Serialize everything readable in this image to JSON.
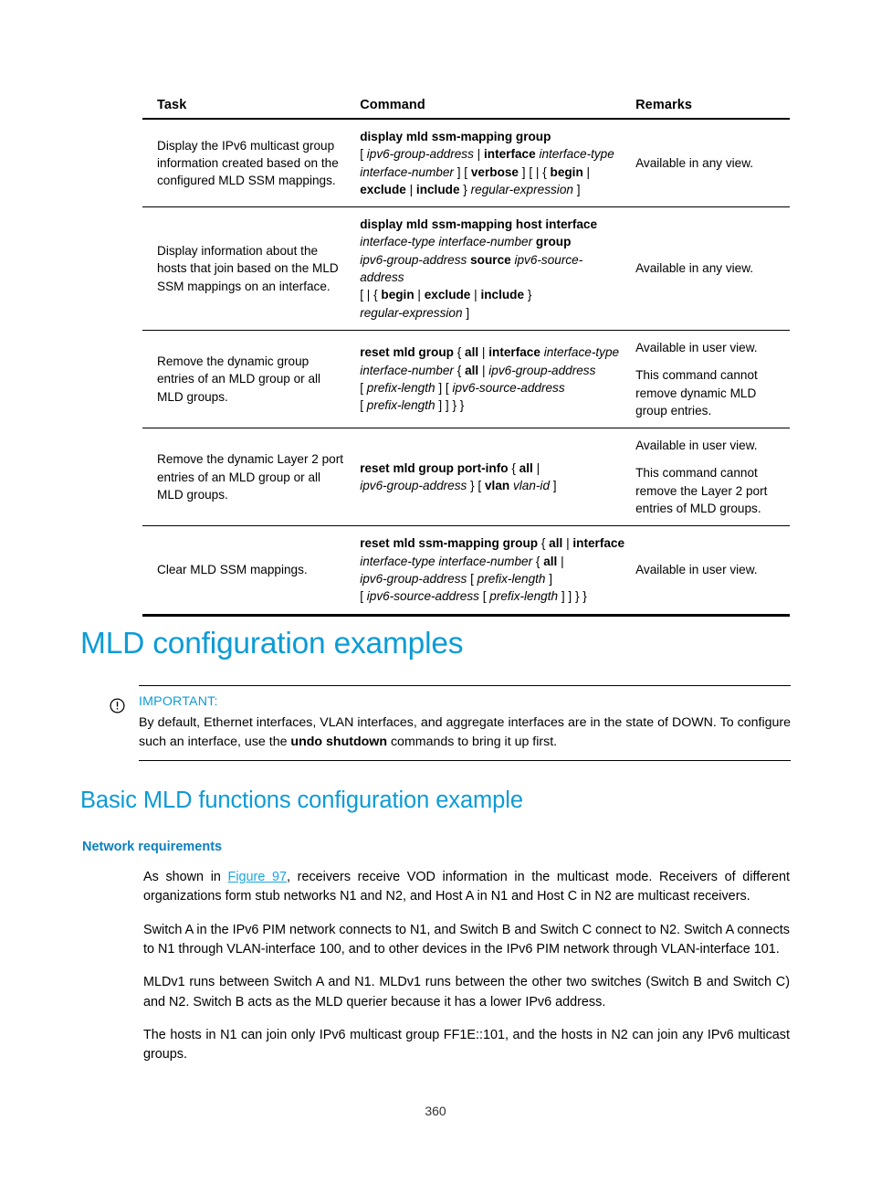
{
  "table": {
    "headers": [
      "Task",
      "Command",
      "Remarks"
    ],
    "rows": [
      {
        "task": "Display the IPv6 multicast group information created based on the configured MLD SSM mappings.",
        "command_lines": [
          [
            {
              "t": "display mld ssm-mapping group",
              "s": "kw"
            }
          ],
          [
            {
              "t": "[ ",
              "s": "p"
            },
            {
              "t": "ipv6-group-address",
              "s": "arg"
            },
            {
              "t": " | ",
              "s": "p"
            },
            {
              "t": "interface",
              "s": "kw"
            },
            {
              "t": " ",
              "s": "p"
            },
            {
              "t": "interface-type",
              "s": "arg"
            }
          ],
          [
            {
              "t": "interface-number",
              "s": "arg"
            },
            {
              "t": " ] [ ",
              "s": "p"
            },
            {
              "t": "verbose",
              "s": "kw"
            },
            {
              "t": " ] [ | { ",
              "s": "p"
            },
            {
              "t": "begin",
              "s": "kw"
            },
            {
              "t": " |",
              "s": "p"
            }
          ],
          [
            {
              "t": "exclude",
              "s": "kw"
            },
            {
              "t": " | ",
              "s": "p"
            },
            {
              "t": "include",
              "s": "kw"
            },
            {
              "t": " } ",
              "s": "p"
            },
            {
              "t": "regular-expression",
              "s": "arg"
            },
            {
              "t": " ]",
              "s": "p"
            }
          ]
        ],
        "remarks": [
          "Available in any view."
        ]
      },
      {
        "task": "Display information about the hosts that join based on the MLD SSM mappings on an interface.",
        "command_lines": [
          [
            {
              "t": "display mld ssm-mapping host interface",
              "s": "kw"
            }
          ],
          [
            {
              "t": "interface-type interface-number",
              "s": "arg"
            },
            {
              "t": " ",
              "s": "p"
            },
            {
              "t": "group",
              "s": "kw"
            }
          ],
          [
            {
              "t": "ipv6-group-address",
              "s": "arg"
            },
            {
              "t": " ",
              "s": "p"
            },
            {
              "t": "source",
              "s": "kw"
            },
            {
              "t": " ",
              "s": "p"
            },
            {
              "t": "ipv6-source-address",
              "s": "arg"
            }
          ],
          [
            {
              "t": "[ | { ",
              "s": "p"
            },
            {
              "t": "begin",
              "s": "kw"
            },
            {
              "t": " | ",
              "s": "p"
            },
            {
              "t": "exclude",
              "s": "kw"
            },
            {
              "t": " | ",
              "s": "p"
            },
            {
              "t": "include",
              "s": "kw"
            },
            {
              "t": " }",
              "s": "p"
            }
          ],
          [
            {
              "t": "regular-expression",
              "s": "arg"
            },
            {
              "t": " ]",
              "s": "p"
            }
          ]
        ],
        "remarks": [
          "Available in any view."
        ]
      },
      {
        "task": "Remove the dynamic group entries of an MLD group or all MLD groups.",
        "command_lines": [
          [
            {
              "t": "reset mld group",
              "s": "kw"
            },
            {
              "t": " { ",
              "s": "p"
            },
            {
              "t": "all",
              "s": "kw"
            },
            {
              "t": " | ",
              "s": "p"
            },
            {
              "t": "interface",
              "s": "kw"
            },
            {
              "t": " ",
              "s": "p"
            },
            {
              "t": "interface-type",
              "s": "arg"
            }
          ],
          [
            {
              "t": "interface-number",
              "s": "arg"
            },
            {
              "t": " { ",
              "s": "p"
            },
            {
              "t": "all",
              "s": "kw"
            },
            {
              "t": " | ",
              "s": "p"
            },
            {
              "t": "ipv6-group-address",
              "s": "arg"
            }
          ],
          [
            {
              "t": "[ ",
              "s": "p"
            },
            {
              "t": "prefix-length",
              "s": "arg"
            },
            {
              "t": " ] [ ",
              "s": "p"
            },
            {
              "t": "ipv6-source-address",
              "s": "arg"
            }
          ],
          [
            {
              "t": "[ ",
              "s": "p"
            },
            {
              "t": "prefix-length",
              "s": "arg"
            },
            {
              "t": " ] ] } }",
              "s": "p"
            }
          ]
        ],
        "remarks": [
          "Available in user view.",
          "This command cannot remove dynamic MLD group entries."
        ]
      },
      {
        "task": "Remove the dynamic Layer 2 port entries of an MLD group or all MLD groups.",
        "command_lines": [
          [
            {
              "t": "reset mld group port-info",
              "s": "kw"
            },
            {
              "t": " { ",
              "s": "p"
            },
            {
              "t": "all",
              "s": "kw"
            },
            {
              "t": " |",
              "s": "p"
            }
          ],
          [
            {
              "t": "ipv6-group-address",
              "s": "arg"
            },
            {
              "t": " } [ ",
              "s": "p"
            },
            {
              "t": "vlan",
              "s": "kw"
            },
            {
              "t": " ",
              "s": "p"
            },
            {
              "t": "vlan-id",
              "s": "arg"
            },
            {
              "t": " ]",
              "s": "p"
            }
          ]
        ],
        "remarks": [
          "Available in user view.",
          "This command cannot remove the Layer 2 port entries of MLD groups."
        ]
      },
      {
        "task": "Clear MLD SSM mappings.",
        "command_lines": [
          [
            {
              "t": "reset mld ssm-mapping group",
              "s": "kw"
            },
            {
              "t": " { ",
              "s": "p"
            },
            {
              "t": "all",
              "s": "kw"
            },
            {
              "t": " | ",
              "s": "p"
            },
            {
              "t": "interface",
              "s": "kw"
            }
          ],
          [
            {
              "t": "interface-type interface-number",
              "s": "arg"
            },
            {
              "t": " { ",
              "s": "p"
            },
            {
              "t": "all",
              "s": "kw"
            },
            {
              "t": " |",
              "s": "p"
            }
          ],
          [
            {
              "t": "ipv6-group-address",
              "s": "arg"
            },
            {
              "t": " [ ",
              "s": "p"
            },
            {
              "t": "prefix-length",
              "s": "arg"
            },
            {
              "t": " ]",
              "s": "p"
            }
          ],
          [
            {
              "t": "[ ",
              "s": "p"
            },
            {
              "t": "ipv6-source-address",
              "s": "arg"
            },
            {
              "t": " [ ",
              "s": "p"
            },
            {
              "t": "prefix-length",
              "s": "arg"
            },
            {
              "t": " ] ] } }",
              "s": "p"
            }
          ]
        ],
        "remarks": [
          "Available in user view."
        ]
      }
    ]
  },
  "headings": {
    "h1": "MLD configuration examples",
    "h2": "Basic MLD functions configuration example",
    "h3": "Network requirements"
  },
  "note": {
    "icon": "important-icon",
    "title": "IMPORTANT:",
    "text_before_bold": "By default, Ethernet interfaces, VLAN interfaces, and aggregate interfaces are in the state of DOWN. To configure such an interface, use the ",
    "bold": "undo shutdown",
    "text_after_bold": " commands to bring it up first."
  },
  "paragraphs": {
    "p1_a": "As shown in ",
    "p1_link": "Figure 97",
    "p1_b": ", receivers receive VOD information in the multicast mode. Receivers of different organizations form stub networks N1 and N2, and Host A in N1 and Host C in N2 are multicast receivers.",
    "p2": "Switch A in the IPv6 PIM network connects to N1, and Switch B and Switch C connect to N2. Switch A connects to N1 through VLAN-interface 100, and to other devices in the IPv6 PIM network through VLAN-interface 101.",
    "p3": "MLDv1 runs between Switch A and N1. MLDv1 runs between the other two switches (Switch B and Switch C) and N2. Switch B acts as the MLD querier because it has a lower IPv6 address.",
    "p4": "The hosts in N1 can join only IPv6 multicast group FF1E::101, and the hosts in N2 can join any IPv6 multicast groups."
  },
  "footer": {
    "page_number": "360"
  },
  "colors": {
    "heading": "#0b9bd6",
    "subheading": "#0b7ec2",
    "link": "#1ba5de"
  }
}
